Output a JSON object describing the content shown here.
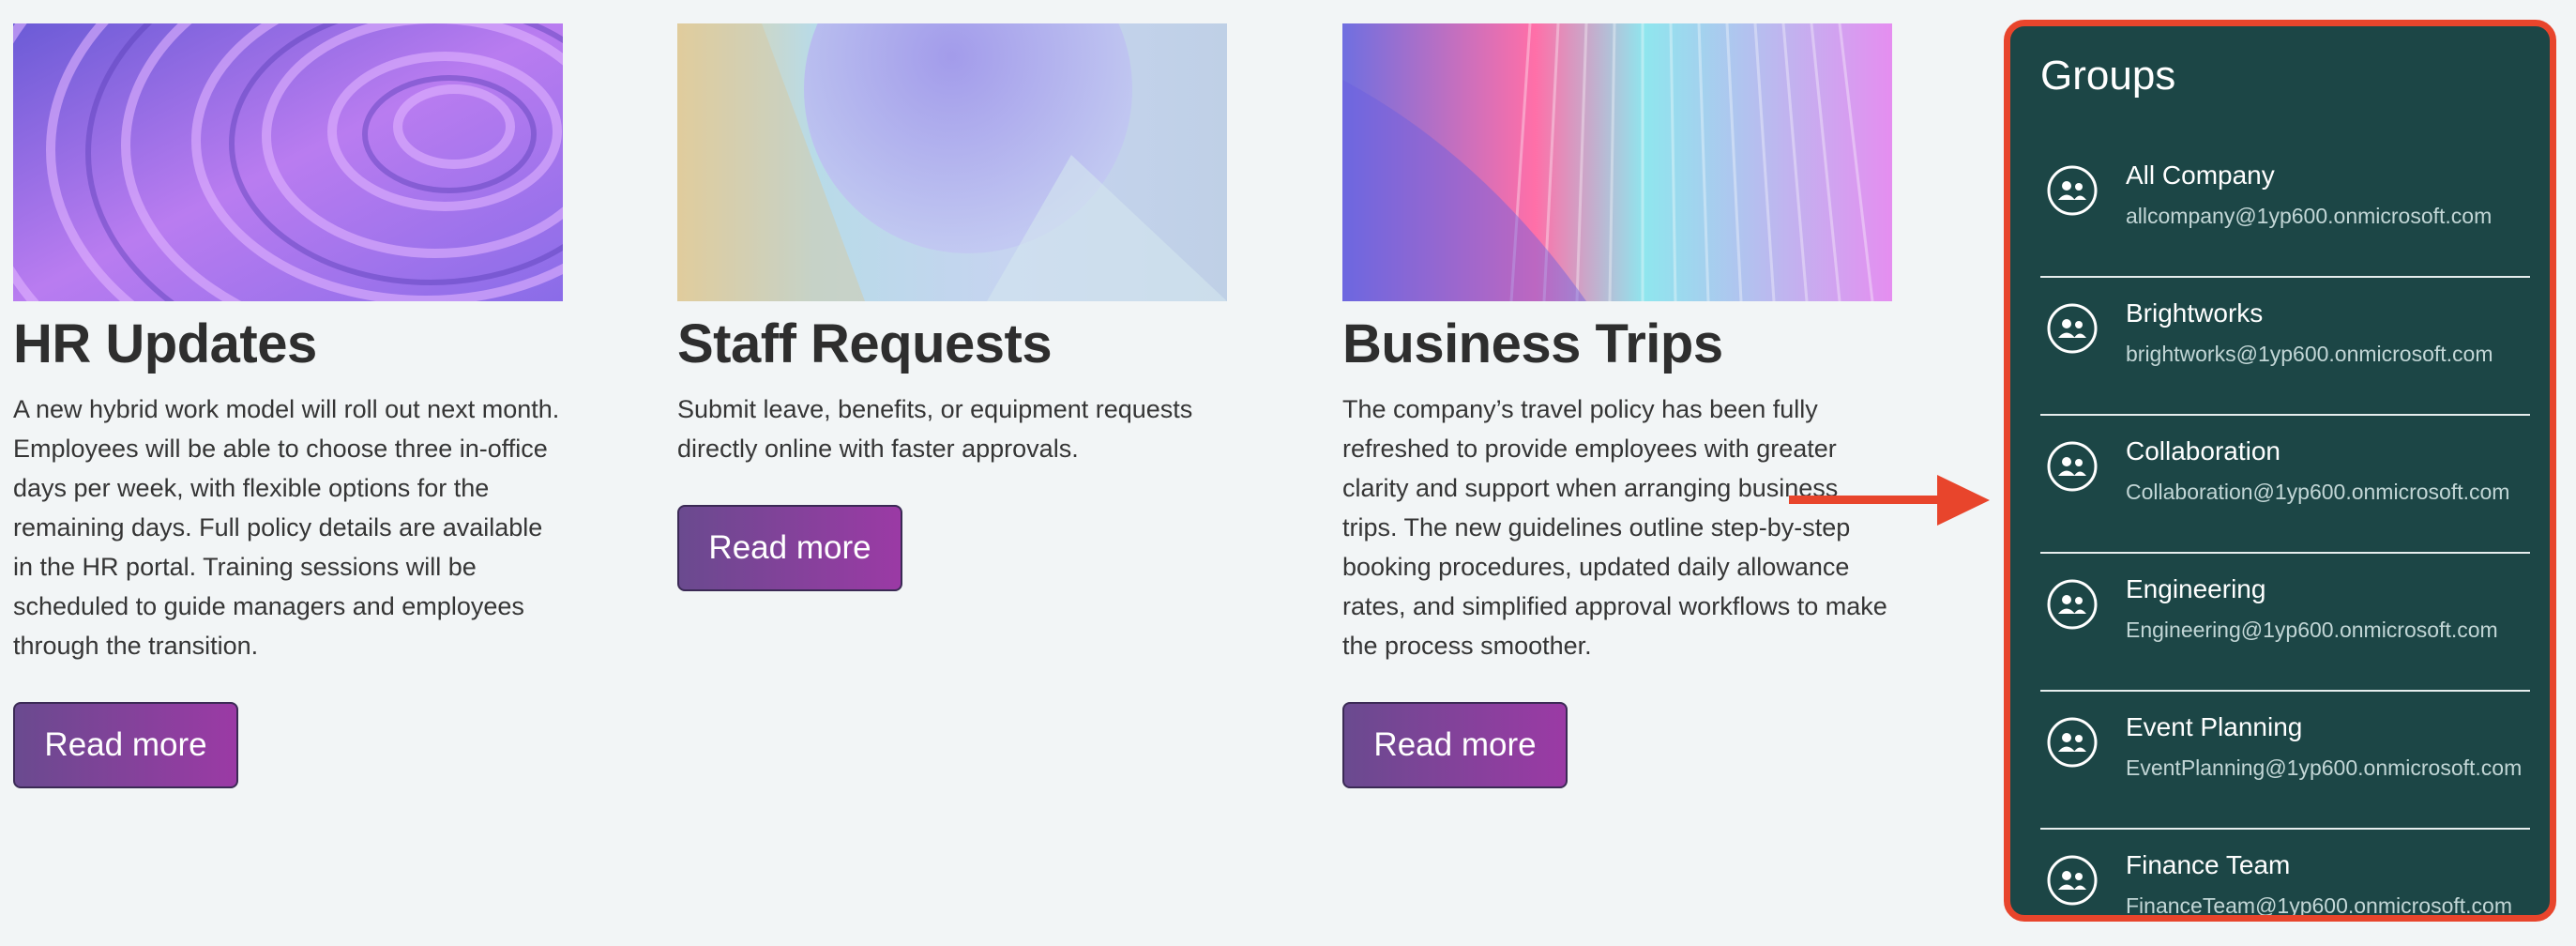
{
  "cards": [
    {
      "title": "HR Updates",
      "body": "A new hybrid work model will roll out next month. Employees will be able to choose three in-office days per week, with flexible options for the remaining days. Full policy details are available in the HR portal. Training sessions will be scheduled to guide managers and employees through the transition.",
      "button": "Read more"
    },
    {
      "title": "Staff Requests",
      "body": "Submit leave, benefits, or equipment requests directly online with faster approvals.",
      "button": "Read more"
    },
    {
      "title": "Business Trips",
      "body": "The company’s travel policy has been fully refreshed to provide employees with greater clarity and support when arranging business trips. The new guidelines outline step-by-step booking procedures, updated daily allowance rates, and simplified approval workflows to make the process smoother.",
      "button": "Read more"
    }
  ],
  "groups_panel": {
    "title": "Groups",
    "items": [
      {
        "name": "All Company",
        "email": "allcompany@1yp600.onmicrosoft.com",
        "icon": "group-icon"
      },
      {
        "name": "Brightworks",
        "email": "brightworks@1yp600.onmicrosoft.com",
        "icon": "group-icon"
      },
      {
        "name": "Collaboration",
        "email": "Collaboration@1yp600.onmicrosoft.com",
        "icon": "group-icon"
      },
      {
        "name": "Engineering",
        "email": "Engineering@1yp600.onmicrosoft.com",
        "icon": "group-icon"
      },
      {
        "name": "Event Planning",
        "email": "EventPlanning@1yp600.onmicrosoft.com",
        "icon": "group-icon"
      },
      {
        "name": "Finance Team",
        "email": "FinanceTeam@1yp600.onmicrosoft.com",
        "icon": "group-icon"
      }
    ]
  },
  "colors": {
    "panel_background": "#1c4646",
    "highlight": "#e8452c",
    "button_gradient_start": "#6a4a8f",
    "button_gradient_end": "#9b3aa5"
  }
}
